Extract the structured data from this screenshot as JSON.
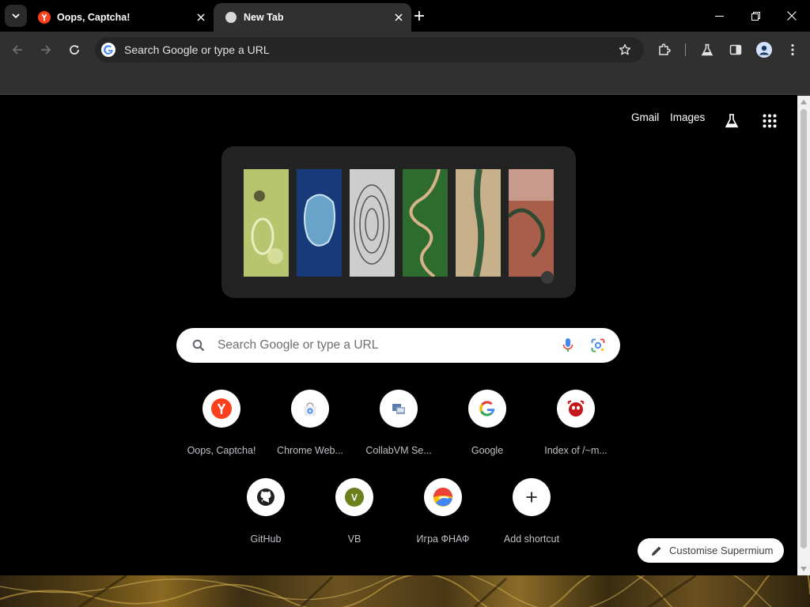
{
  "tabs": [
    {
      "title": "Oops, Captcha!",
      "active": false,
      "favicon": "yandex-icon"
    },
    {
      "title": "New Tab",
      "active": true,
      "favicon": "globe-icon"
    }
  ],
  "toolbar": {
    "omnibox_text": "Search Google or type a URL"
  },
  "header_links": {
    "gmail": "Gmail",
    "images": "Images"
  },
  "search": {
    "placeholder": "Search Google or type a URL"
  },
  "shortcuts": [
    {
      "label": "Oops, Captcha!",
      "icon": "yandex-icon"
    },
    {
      "label": "Chrome Web...",
      "icon": "chrome-web-store-icon"
    },
    {
      "label": "CollabVM Se...",
      "icon": "collabvm-icon"
    },
    {
      "label": "Google",
      "icon": "google-icon"
    },
    {
      "label": "Index of /~m...",
      "icon": "freebsd-icon"
    },
    {
      "label": "GitHub",
      "icon": "github-icon"
    },
    {
      "label": "VB",
      "icon": "letter-v-icon",
      "letter": "V"
    },
    {
      "label": "Игра ФНАФ",
      "icon": "colorful-ball-icon"
    },
    {
      "label": "Add shortcut",
      "icon": "plus-icon"
    }
  ],
  "customise": {
    "label": "Customise Supermium"
  },
  "colors": {
    "accent_red": "#fc3f1d",
    "tab_active_bg": "#303030",
    "page_bg": "#000000"
  }
}
